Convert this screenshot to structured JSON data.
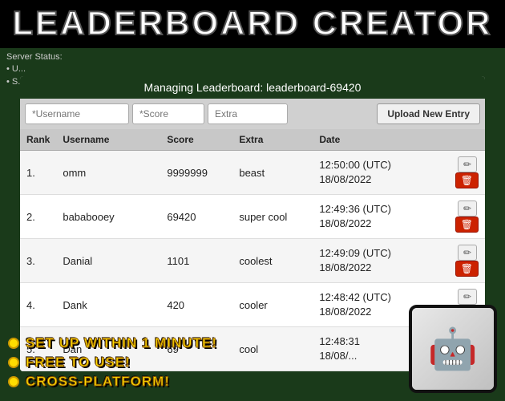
{
  "header": {
    "title": "LEADERBOARD CREATOR"
  },
  "server_status": {
    "label": "Server Status:",
    "line1": "• U...",
    "line2": "• S..."
  },
  "managing": {
    "prefix": "Managing Leaderboard:",
    "id": "leaderboard-69420"
  },
  "inputs": {
    "username_placeholder": "*Username",
    "score_placeholder": "*Score",
    "extra_placeholder": "Extra",
    "upload_button": "Upload New Entry"
  },
  "table": {
    "headers": [
      "Rank",
      "Username",
      "Score",
      "Extra",
      "Date",
      ""
    ],
    "rows": [
      {
        "rank": "1.",
        "username": "omm",
        "score": "9999999",
        "extra": "beast",
        "date_line1": "12:50:00 (UTC)",
        "date_line2": "18/08/2022"
      },
      {
        "rank": "2.",
        "username": "bababooey",
        "score": "69420",
        "extra": "super cool",
        "date_line1": "12:49:36 (UTC)",
        "date_line2": "18/08/2022"
      },
      {
        "rank": "3.",
        "username": "Danial",
        "score": "1101",
        "extra": "coolest",
        "date_line1": "12:49:09 (UTC)",
        "date_line2": "18/08/2022"
      },
      {
        "rank": "4.",
        "username": "Dank",
        "score": "420",
        "extra": "cooler",
        "date_line1": "12:48:42 (UTC)",
        "date_line2": "18/08/2022"
      },
      {
        "rank": "5.",
        "username": "Dan",
        "score": "69",
        "extra": "cool",
        "date_line1": "12:48:31",
        "date_line2": "18/08/..."
      }
    ],
    "edit_label": "✏",
    "delete_label": "🗑"
  },
  "promo": {
    "bullets": [
      "SET UP WITHIN 1 MINUTE!",
      "FREE TO USE!",
      "CROSS-PLATFORM!"
    ]
  }
}
